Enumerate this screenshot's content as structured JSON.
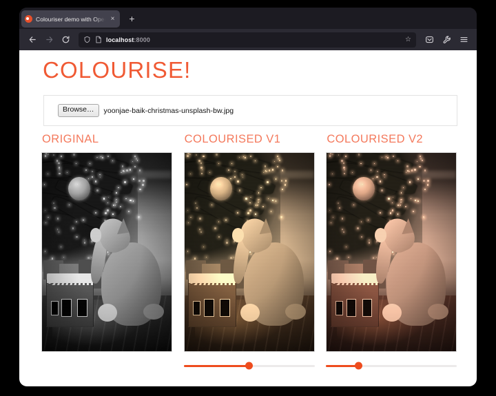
{
  "browser": {
    "tab": {
      "title": "Colouriser demo with OpenVINO",
      "favicon": "app-favicon",
      "close_label": "×"
    },
    "new_tab_label": "+",
    "nav": {
      "back": "back-arrow",
      "forward": "forward-arrow",
      "reload": "reload-arrow"
    },
    "url": {
      "host": "localhost",
      "port": ":8000",
      "shield_icon": "shield-icon",
      "page_icon": "page-icon",
      "bookmark_label": "☆"
    },
    "toolbar": {
      "pocket": "pocket-icon",
      "wrench": "wrench-icon",
      "menu": "hamburger-menu-icon"
    }
  },
  "page": {
    "title": "COLOURISE!",
    "accent_color": "#f05a34",
    "heading_color": "#f4795c",
    "slider_color": "#ee4c1e",
    "file_input": {
      "browse_label": "Browse…",
      "filename": "yoonjae-baik-christmas-unsplash-bw.jpg"
    },
    "columns": [
      {
        "id": "original",
        "title": "ORIGINAL",
        "tone": "tone-bw",
        "has_slider": false,
        "slider_value": 0
      },
      {
        "id": "colourised-v1",
        "title": "COLOURISED V1",
        "tone": "tone-v1",
        "has_slider": true,
        "slider_value": 50
      },
      {
        "id": "colourised-v2",
        "title": "COLOURISED V2",
        "tone": "tone-v2",
        "has_slider": true,
        "slider_value": 25
      }
    ]
  }
}
